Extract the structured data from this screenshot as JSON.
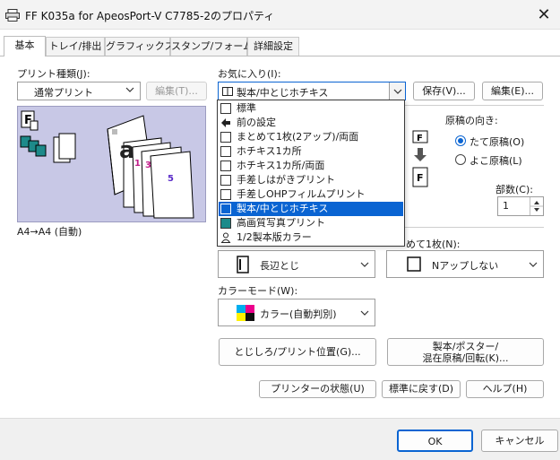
{
  "window": {
    "title": "FF K035a for ApeosPort-V C7785-2のプロパティ",
    "close": "✕"
  },
  "tabs": [
    "基本",
    "トレイ/排出",
    "グラフィックス",
    "スタンプ/フォーム",
    "詳細設定"
  ],
  "print_type": {
    "label": "プリント種類(J):",
    "value": "通常プリント",
    "edit_button": "編集(T)..."
  },
  "preview": {
    "caption": "A4→A4 (自動)",
    "doc_letter": "a",
    "page_numbers": [
      "1",
      "3",
      "5"
    ]
  },
  "favorites": {
    "label": "お気に入り(I):",
    "value": "製本/中とじホチキス",
    "save_button": "保存(V)...",
    "edit_button": "編集(E)...",
    "options": [
      "標準",
      "前の設定",
      "まとめて1枚(2アップ)/両面",
      "ホチキス1カ所",
      "ホチキス1カ所/両面",
      "手差しはがきプリント",
      "手差しOHPフィルムプリント",
      "製本/中とじホチキス",
      "高画質写真プリント",
      "1/2製本版カラー"
    ],
    "selected_index": 7
  },
  "orientation": {
    "label": "原稿の向き:",
    "portrait": "たて原稿(O)",
    "landscape": "よこ原稿(L)",
    "selected": "portrait"
  },
  "copies": {
    "label": "部数(C):",
    "value": "1"
  },
  "nup": {
    "label_tail": "めて1枚(N):",
    "value": "Nアップしない"
  },
  "binding": {
    "value": "長辺とじ"
  },
  "color_mode": {
    "label": "カラーモード(W):",
    "value": "カラー(自動判別)"
  },
  "buttons": {
    "margin": "とじしろ/プリント位置(G)...",
    "booklet_line1": "製本/ポスター/",
    "booklet_line2": "混在原稿/回転(K)...",
    "printer_status": "プリンターの状態(U)",
    "restore_default": "標準に戻す(D)",
    "help": "ヘルプ(H)",
    "ok": "OK",
    "cancel": "キャンセル"
  },
  "colors": {
    "accent": "#0a64d2",
    "preview_bg": "#c8c8e6"
  }
}
